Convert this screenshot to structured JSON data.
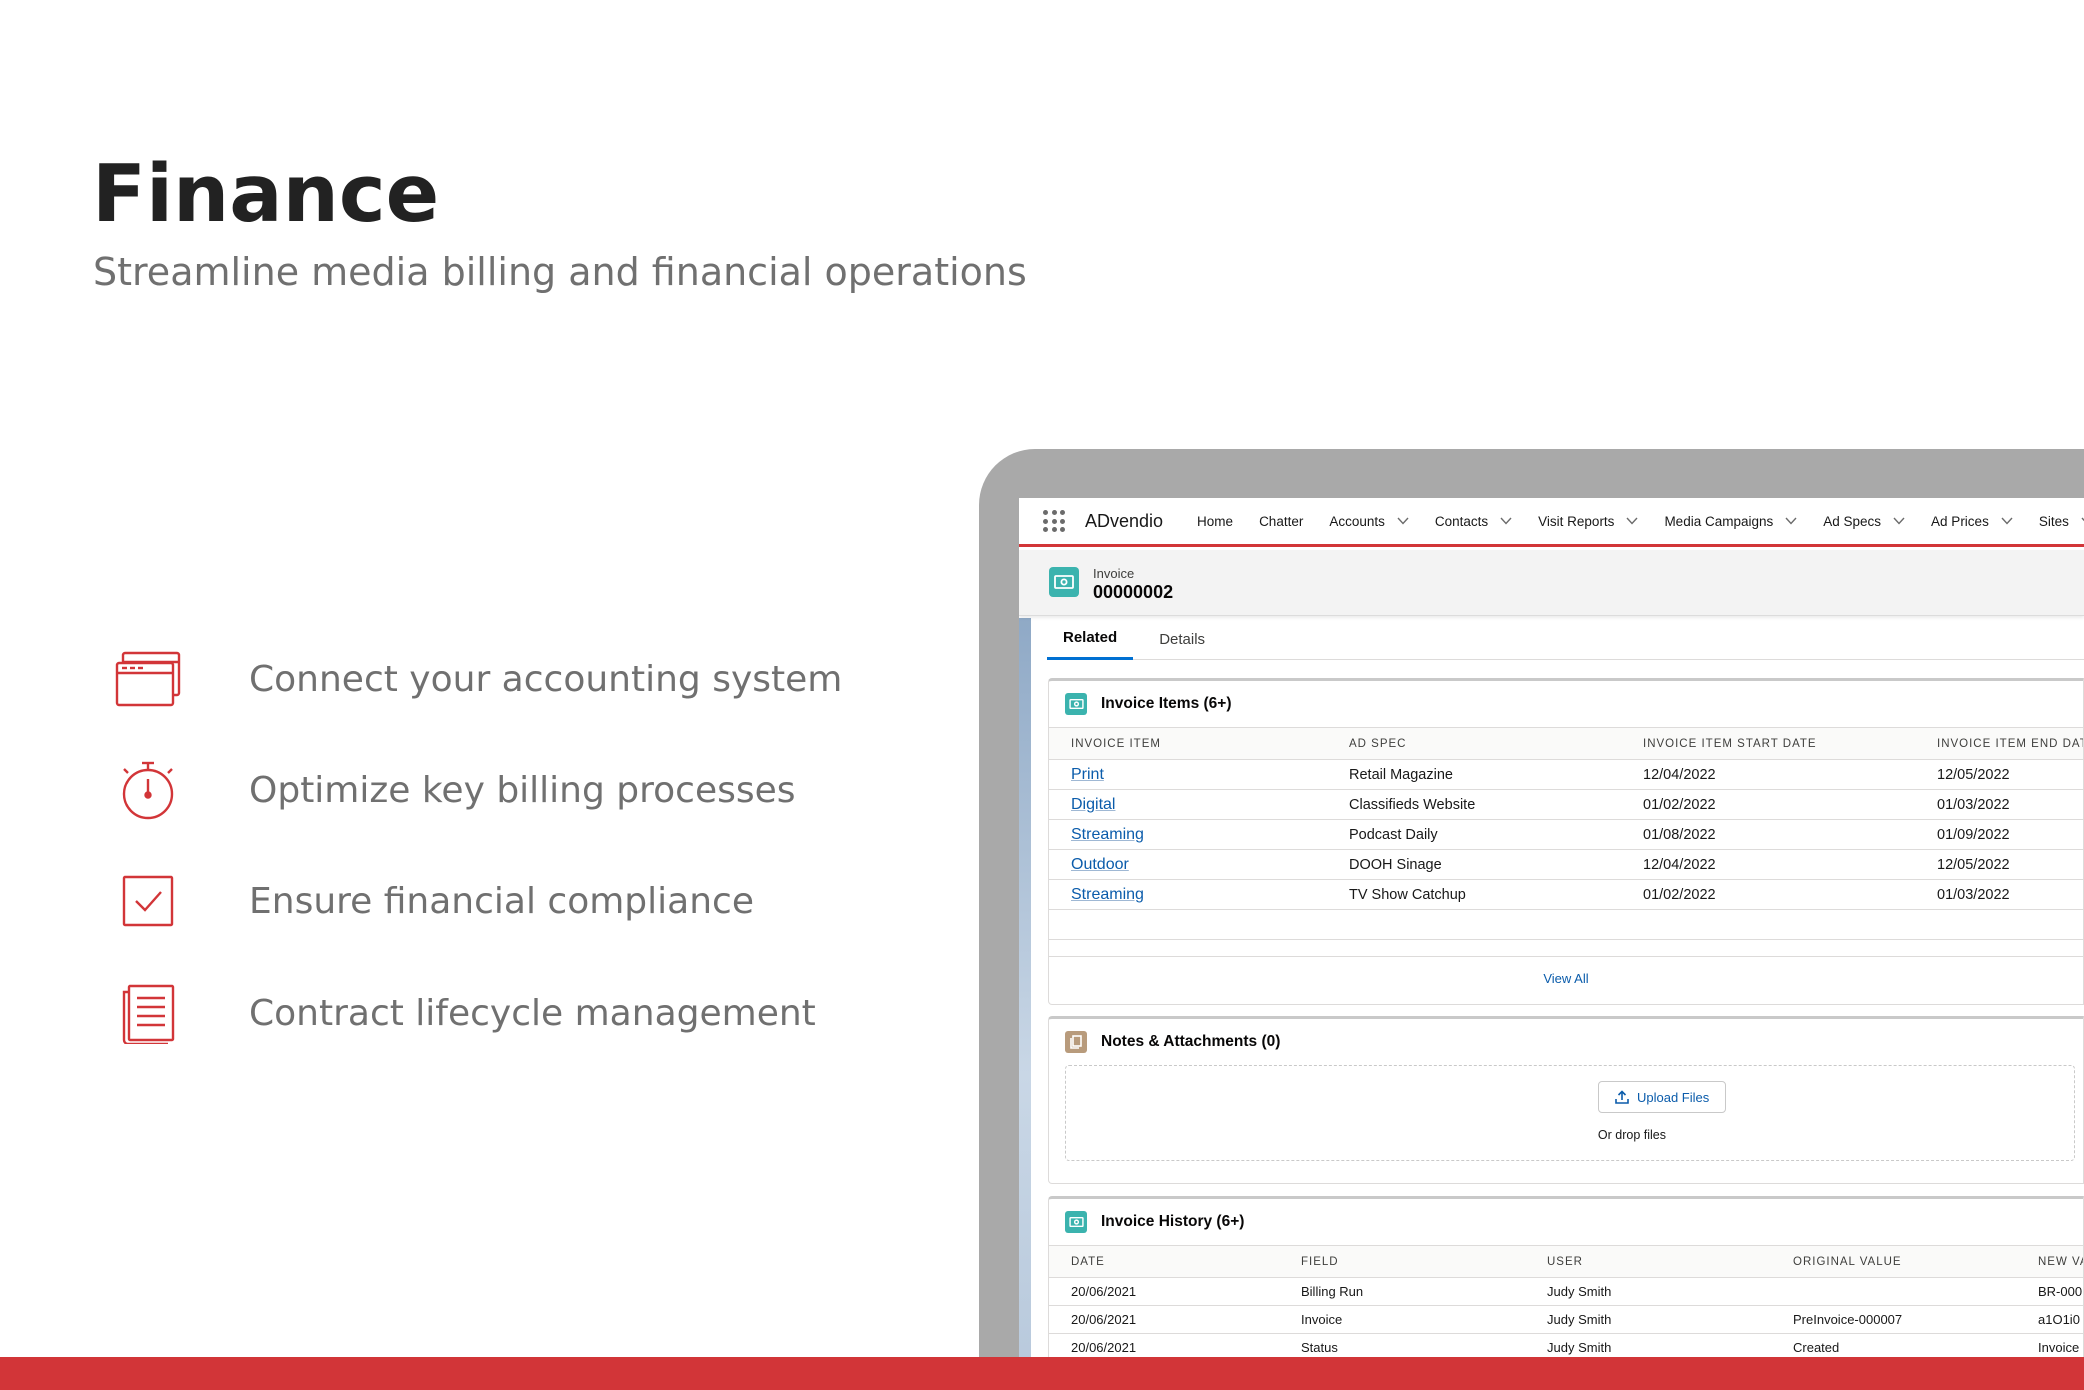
{
  "hero": {
    "title": "Finance",
    "subtitle": "Streamline media billing and financial operations"
  },
  "features": [
    {
      "icon": "browser-window-icon",
      "label": "Connect your accounting system"
    },
    {
      "icon": "stopwatch-icon",
      "label": "Optimize key billing processes"
    },
    {
      "icon": "checkbox-checked-icon",
      "label": "Ensure financial compliance"
    },
    {
      "icon": "document-list-icon",
      "label": "Contract lifecycle management"
    }
  ],
  "colors": {
    "brand_red": "#d23538",
    "record_teal": "#3bb3ae",
    "notes_tan": "#b89b7c",
    "link_blue": "#0b5cab"
  },
  "app": {
    "name": "ADvendio",
    "nav": [
      {
        "label": "Home",
        "has_menu": false
      },
      {
        "label": "Chatter",
        "has_menu": false
      },
      {
        "label": "Accounts",
        "has_menu": true
      },
      {
        "label": "Contacts",
        "has_menu": true
      },
      {
        "label": "Visit Reports",
        "has_menu": true
      },
      {
        "label": "Media Campaigns",
        "has_menu": true
      },
      {
        "label": "Ad Specs",
        "has_menu": true
      },
      {
        "label": "Ad Prices",
        "has_menu": true
      },
      {
        "label": "Sites",
        "has_menu": true
      }
    ]
  },
  "record": {
    "object_label": "Invoice",
    "name": "00000002",
    "tabs": [
      {
        "label": "Related",
        "active": true
      },
      {
        "label": "Details",
        "active": false
      }
    ]
  },
  "invoice_items": {
    "title": "Invoice Items (6+)",
    "columns": [
      "Invoice Item",
      "Ad Spec",
      "Invoice Item Start Date",
      "Invoice Item End Date"
    ],
    "rows": [
      [
        "Print",
        "Retail Magazine",
        "12/04/2022",
        "12/05/2022"
      ],
      [
        "Digital",
        "Classifieds Website",
        "01/02/2022",
        "01/03/2022"
      ],
      [
        "Streaming",
        "Podcast Daily",
        "01/08/2022",
        "01/09/2022"
      ],
      [
        "Outdoor",
        "DOOH Sinage",
        "12/04/2022",
        "12/05/2022"
      ],
      [
        "Streaming",
        "TV Show Catchup",
        "01/02/2022",
        "01/03/2022"
      ]
    ],
    "view_all": "View All"
  },
  "notes": {
    "title": "Notes & Attachments (0)",
    "upload_label": "Upload Files",
    "drop_label": "Or drop files"
  },
  "invoice_history": {
    "title": "Invoice History (6+)",
    "columns": [
      "Date",
      "Field",
      "User",
      "Original Value",
      "New Value"
    ],
    "rows": [
      [
        "20/06/2021",
        "Billing Run",
        "Judy Smith",
        "",
        "BR-000"
      ],
      [
        "20/06/2021",
        "Invoice",
        "Judy Smith",
        "PreInvoice-000007",
        "a1O1i0"
      ],
      [
        "20/06/2021",
        "Status",
        "Judy Smith",
        "Created",
        "Invoice"
      ]
    ]
  }
}
